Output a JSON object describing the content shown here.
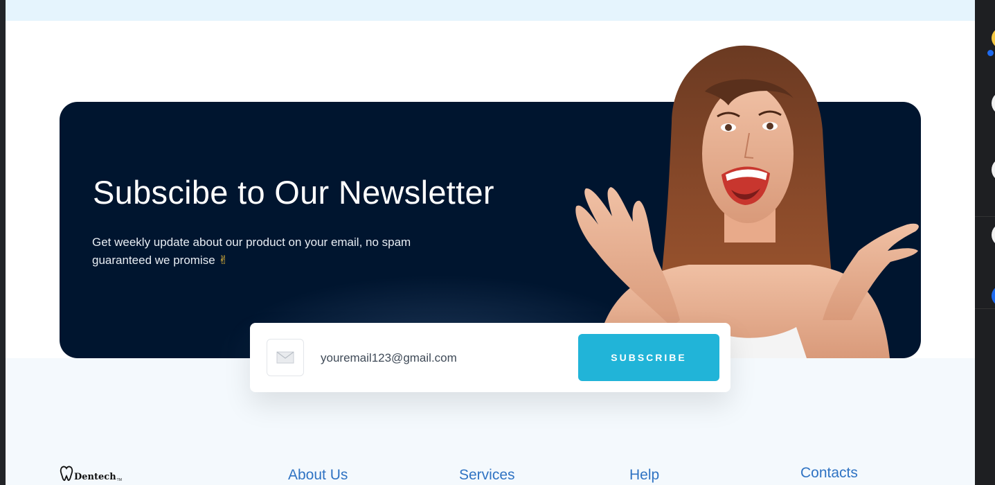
{
  "newsletter": {
    "title": "Subscibe to Our Newsletter",
    "description": "Get weekly update about our product on your email, no spam guaranteed we promise",
    "emoji": "✌",
    "email_value": "youremail123@gmail.com",
    "subscribe_label": "SUBSCRIBE"
  },
  "footer": {
    "logo_text": "Dentech",
    "logo_tm": "TM",
    "links": [
      "About Us",
      "Services",
      "Help",
      "Contacts"
    ]
  },
  "colors": {
    "banner": "#00152f",
    "accent": "#21b4d8",
    "link": "#2f73c3",
    "top_band": "#e5f4fd",
    "footer_bg": "#f4f9fd"
  },
  "icons": [
    "envelope-icon",
    "tooth-logo-icon"
  ]
}
